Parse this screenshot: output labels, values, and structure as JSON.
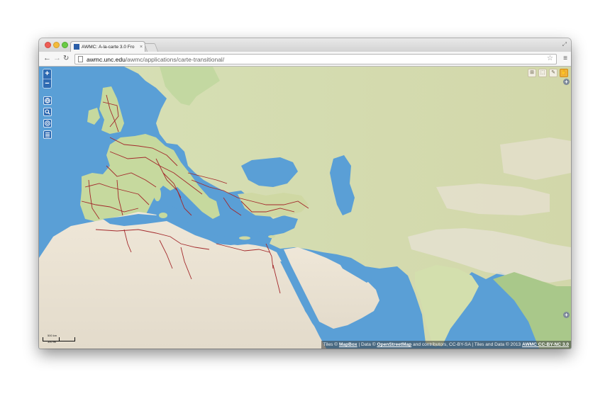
{
  "browser": {
    "tab_title": "AWMC: À-la-carte 3.0 Fro",
    "tab_close": "×",
    "url_host": "awmc.unc.edu",
    "url_path": "/awmc/applications/carte-transitional/"
  },
  "map": {
    "zoom_in": "+",
    "zoom_out": "−",
    "tools": [
      "globe-icon",
      "search-icon",
      "help-icon",
      "list-icon"
    ],
    "layer_buttons": [
      "grid-icon",
      "frame-icon",
      "draw-icon",
      "hand-icon"
    ],
    "expand_label": "+",
    "scale_top": "500 km",
    "scale_bottom": "300 mi",
    "attribution": {
      "tiles_prefix": "Tiles © ",
      "mapbox": "MapBox",
      "data_prefix": " | Data © ",
      "osm": "OpenStreetMap",
      "osm_suffix": " and contributors, CC-BY-SA | Tiles and Data © 2013 ",
      "awmc": "AWMC CC-BY-NC 3.0"
    },
    "colors": {
      "water": "#5a9fd6",
      "land_green": "#c8dba3",
      "land_desert": "#e9e1d2",
      "roads": "#a3282b",
      "controls": "#2e6ab2"
    }
  }
}
